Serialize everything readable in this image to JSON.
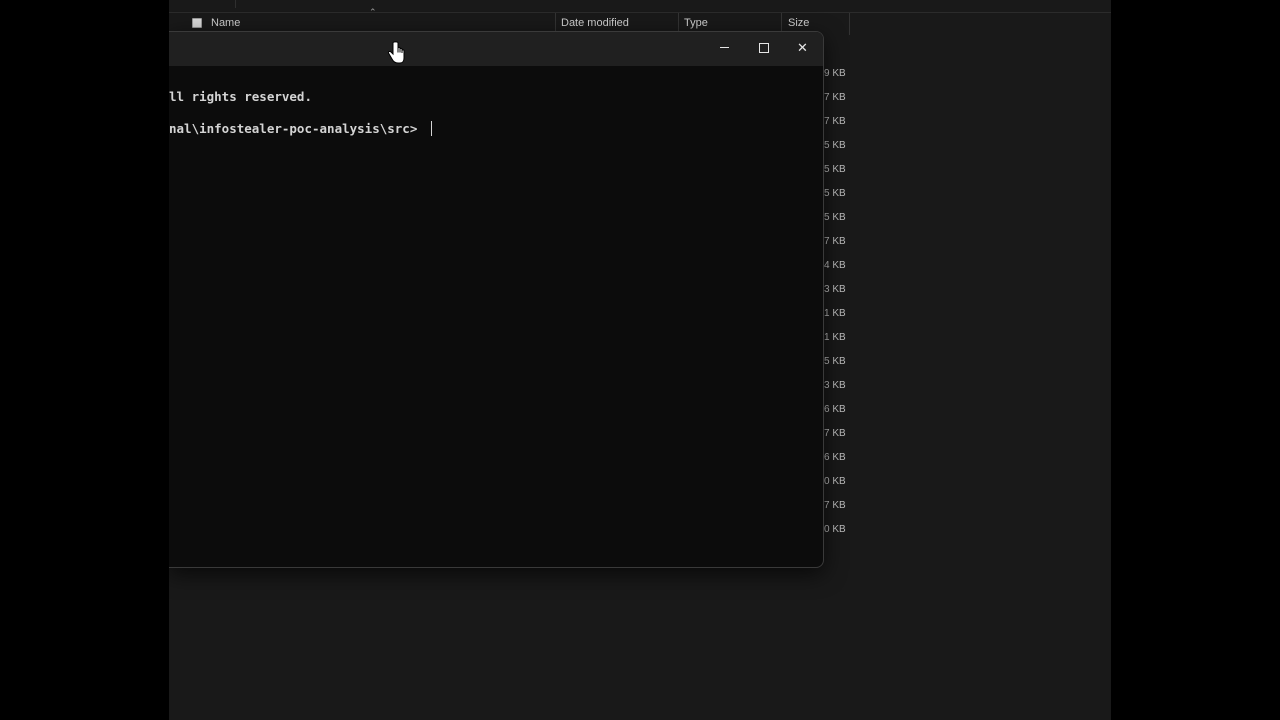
{
  "explorer": {
    "columns": {
      "name": "Name",
      "date_modified": "Date modified",
      "type": "Type",
      "size": "Size"
    },
    "sizes": [
      "9 KB",
      "7 KB",
      "7 KB",
      "5 KB",
      "5 KB",
      "5 KB",
      "5 KB",
      "7 KB",
      "4 KB",
      "3 KB",
      "1 KB",
      "1 KB",
      "5 KB",
      "3 KB",
      "6 KB",
      "7 KB",
      "6 KB",
      "0 KB",
      "7 KB",
      "0 KB"
    ]
  },
  "terminal": {
    "lines": [
      "ll rights reserved.",
      "nal\\infostealer-poc-analysis\\src> "
    ],
    "buttons": {
      "minimize_icon": "minimize-icon",
      "maximize_icon": "maximize-icon",
      "close_icon": "close-icon",
      "close_glyph": "✕"
    }
  },
  "colors": {
    "desktop": "#000000",
    "explorer_bg": "#191919",
    "terminal_bg": "#0c0c0c",
    "titlebar_bg": "#202020",
    "text": "#d4d4d4"
  }
}
